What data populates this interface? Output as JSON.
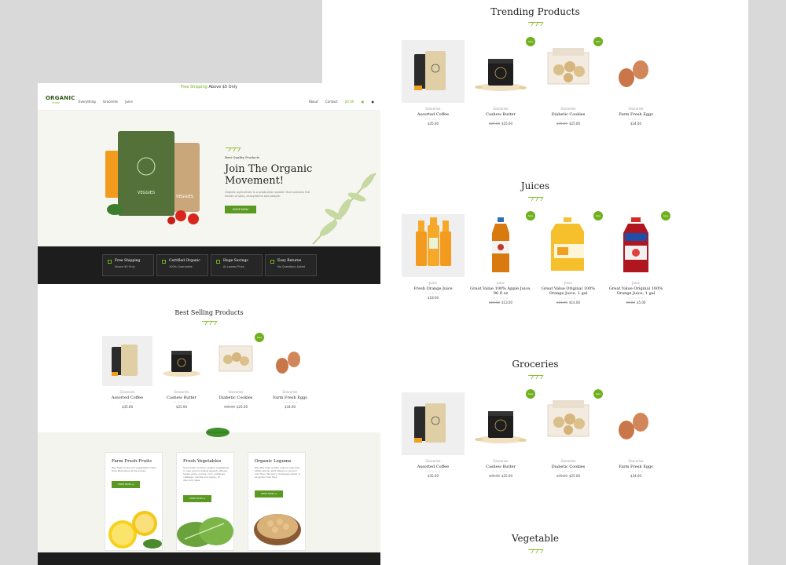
{
  "trending": {
    "title": "Trending Products",
    "products": [
      {
        "category": "Groceries",
        "name": "Assorted Coffee",
        "stars": "☆☆☆☆☆",
        "old_price": "",
        "price": "$35.00",
        "sale": ""
      },
      {
        "category": "Groceries",
        "name": "Cashew Butter",
        "stars": "☆☆☆☆☆",
        "old_price": "$25.00",
        "price": "$25.00",
        "sale": "Sale"
      },
      {
        "category": "Groceries",
        "name": "Diabetic Cookies",
        "stars": "☆☆☆☆☆",
        "old_price": "$35.00",
        "price": "$25.00",
        "sale": "Sale"
      },
      {
        "category": "Groceries",
        "name": "Farm Fresh Eggs",
        "stars": "☆☆☆☆☆",
        "old_price": "",
        "price": "$34.00",
        "sale": ""
      }
    ]
  },
  "juices": {
    "title": "Juices",
    "products": [
      {
        "category": "Juice",
        "name": "Fresh Orange Juice",
        "stars": "☆☆☆☆☆",
        "old_price": "",
        "price": "$18.00",
        "sale": ""
      },
      {
        "category": "Juice",
        "name": "Great Value 100% Apple Juice, 96 fl oz",
        "stars": "☆☆☆☆☆",
        "old_price": "$15.00",
        "price": "$13.00",
        "sale": "Sale"
      },
      {
        "category": "Juice",
        "name": "Great Value Original 100% Orange Juice, 1 gal",
        "stars": "☆☆☆☆☆",
        "old_price": "$15.00",
        "price": "$14.00",
        "sale": "Sale"
      },
      {
        "category": "Juice",
        "name": "Great Value Original 100% Orange Juice, 1 gal",
        "stars": "☆☆☆☆☆",
        "old_price": "$8.00",
        "price": "$5.00",
        "sale": "Sale"
      }
    ]
  },
  "groceries": {
    "title": "Groceries",
    "products": [
      {
        "category": "Groceries",
        "name": "Assorted Coffee",
        "stars": "☆☆☆☆☆",
        "old_price": "",
        "price": "$35.00",
        "sale": ""
      },
      {
        "category": "Groceries",
        "name": "Cashew Butter",
        "stars": "☆☆☆☆☆",
        "old_price": "$25.00",
        "price": "$25.00",
        "sale": "Sale"
      },
      {
        "category": "Groceries",
        "name": "Diabetic Cookies",
        "stars": "☆☆☆☆☆",
        "old_price": "$35.00",
        "price": "$25.00",
        "sale": "Sale"
      },
      {
        "category": "Groceries",
        "name": "Farm Fresh Eggs",
        "stars": "☆☆☆☆☆",
        "old_price": "",
        "price": "$34.00",
        "sale": ""
      }
    ]
  },
  "vegetable": {
    "title": "Vegetable"
  },
  "left": {
    "topbar": {
      "highlight": "Free Shipping",
      "rest": "Above $5 Only"
    },
    "logo": {
      "text": "ORGANIC",
      "sub": "STORE"
    },
    "nav": [
      "Everything",
      "Groceries",
      "Juice"
    ],
    "nav_right": {
      "about": "About",
      "contact": "Contact",
      "cart": "$0.00"
    },
    "hero": {
      "subtitle": "Best Quality Products",
      "title": "Join The Organic Movement!",
      "text": "Organic agriculture is a production system that sustains the health of soils, ecosystems and people.",
      "button": "SHOP NOW",
      "bag1_label": "VEGGIES",
      "bag2_label": "VEGGIES"
    },
    "features": [
      {
        "title": "Free Shipping",
        "sub": "Above $5 Only"
      },
      {
        "title": "Certified Organic",
        "sub": "100% Guarantee"
      },
      {
        "title": "Huge Savings",
        "sub": "At Lowest Price"
      },
      {
        "title": "Easy Returns",
        "sub": "No Questions Asked"
      }
    ],
    "best_selling": {
      "title": "Best Selling Products",
      "products": [
        {
          "category": "Groceries",
          "name": "Assorted Coffee",
          "stars": "☆☆☆☆☆",
          "old_price": "",
          "price": "$35.00",
          "sale": ""
        },
        {
          "category": "Groceries",
          "name": "Cashew Butter",
          "stars": "☆☆☆☆☆",
          "old_price": "",
          "price": "$25.00",
          "sale": ""
        },
        {
          "category": "Groceries",
          "name": "Diabetic Cookies",
          "stars": "☆☆☆☆☆",
          "old_price": "$35.00",
          "price": "$25.00",
          "sale": "Sale"
        },
        {
          "category": "Groceries",
          "name": "Farm Fresh Eggs",
          "stars": "☆☆☆☆☆",
          "old_price": "",
          "price": "$34.00",
          "sale": ""
        }
      ]
    },
    "categories": [
      {
        "title": "Farm Fresh Fruits",
        "text": "Buy fresh fruits and vegetables online from Farmstore at low prices.",
        "button": "SHOP NOW  ➜"
      },
      {
        "title": "Fresh Vegetables",
        "text": "Shop fresh summer season vegetables in new york including squash, lettuce, herbs, peas, onions, corn, potatoes, cabbage, carrots and celery, at discount rates.",
        "button": "SHOP NOW  ➜"
      },
      {
        "title": "Organic Legume",
        "text": "We offer high quality organic legumes either whole, split, flaked or ground into flour. We carry chickpeas whole or as gluten free flour.",
        "button": "SHOP NOW  ➜"
      }
    ]
  },
  "colors": {
    "accent": "#6fb01f",
    "dark": "#1d1d1d",
    "cream": "#f6f6f1"
  }
}
